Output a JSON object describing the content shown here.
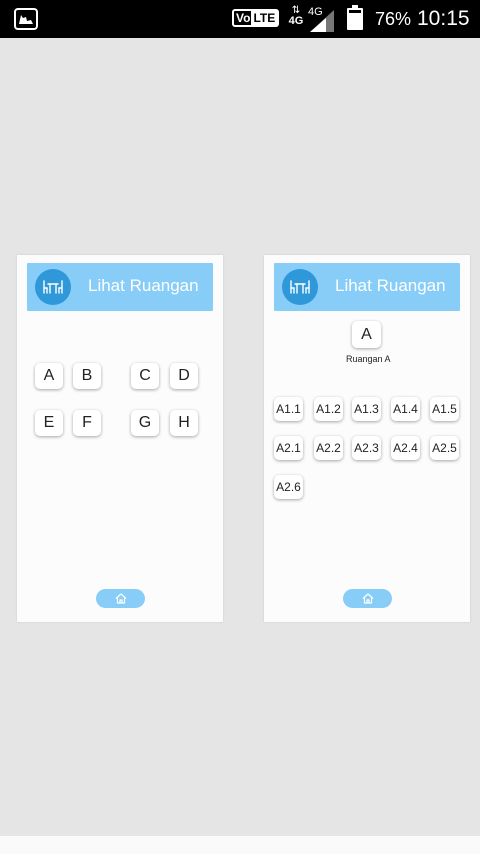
{
  "statusbar": {
    "volte_vo": "Vo",
    "volte_lte": "LTE",
    "network": "4G",
    "network_small": "4G",
    "battery": "76%",
    "time": "10:15"
  },
  "left_card": {
    "title": "Lihat Ruangan",
    "buttons": [
      "A",
      "B",
      "C",
      "D",
      "E",
      "F",
      "G",
      "H"
    ]
  },
  "right_card": {
    "title": "Lihat Ruangan",
    "room_button": "A",
    "room_caption": "Ruangan A",
    "buttons": [
      "A1.1",
      "A1.2",
      "A1.3",
      "A1.4",
      "A1.5",
      "A2.1",
      "A2.2",
      "A2.3",
      "A2.4",
      "A2.5",
      "A2.6"
    ]
  },
  "icons": {
    "header": "table-chairs-icon",
    "home": "home-icon",
    "app": "app-notification-icon"
  },
  "colors": {
    "header": "#87cdf8",
    "icon_circle": "#2f98d9",
    "background": "#e5e5e5"
  }
}
